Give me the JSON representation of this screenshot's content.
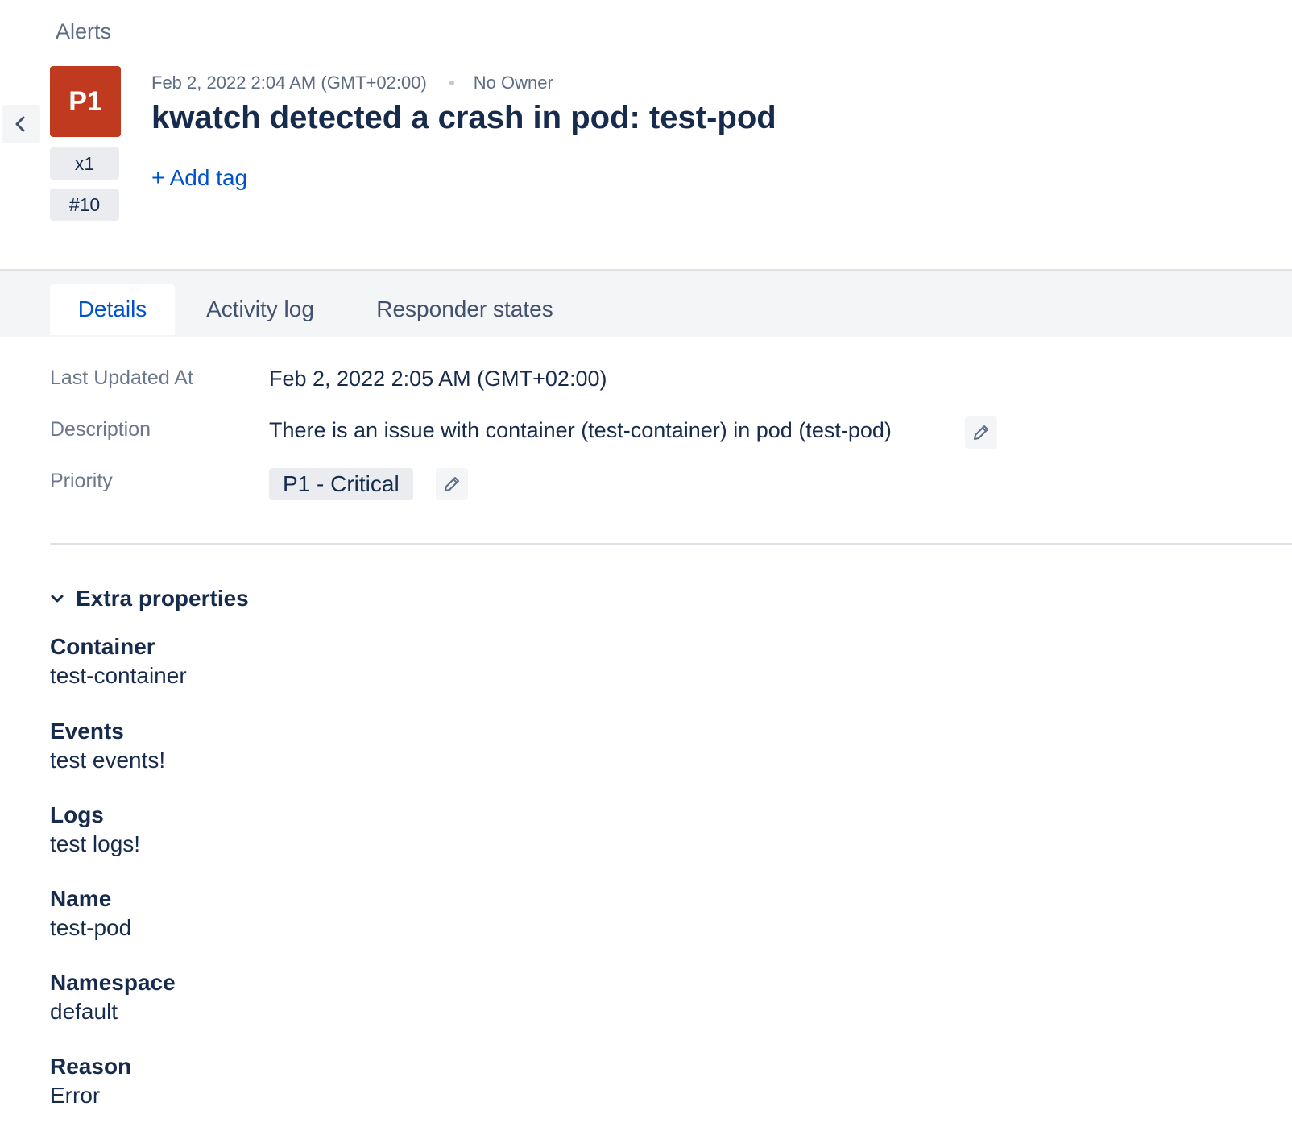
{
  "breadcrumb": "Alerts",
  "alert": {
    "priority_short": "P1",
    "count_label": "x1",
    "number_label": "#10",
    "created_at": "Feb 2, 2022 2:04 AM (GMT+02:00)",
    "owner": "No Owner",
    "title": "kwatch detected a crash in pod: test-pod",
    "add_tag_label": "+ Add tag"
  },
  "tabs": [
    {
      "label": "Details",
      "active": true
    },
    {
      "label": "Activity log",
      "active": false
    },
    {
      "label": "Responder states",
      "active": false
    }
  ],
  "details": {
    "last_updated": {
      "label": "Last Updated At",
      "value": "Feb 2, 2022 2:05 AM (GMT+02:00)"
    },
    "description": {
      "label": "Description",
      "value": "There is an issue with container (test-container) in pod (test-pod)"
    },
    "priority": {
      "label": "Priority",
      "value": "P1 - Critical"
    }
  },
  "extra": {
    "title": "Extra properties",
    "items": [
      {
        "key": "Container",
        "value": "test-container"
      },
      {
        "key": "Events",
        "value": "test events!"
      },
      {
        "key": "Logs",
        "value": "test logs!"
      },
      {
        "key": "Name",
        "value": "test-pod"
      },
      {
        "key": "Namespace",
        "value": "default"
      },
      {
        "key": "Reason",
        "value": "Error"
      }
    ]
  },
  "colors": {
    "priority_p1": "#bf3a1e",
    "link": "#0052cc",
    "text": "#172b4d",
    "muted": "#6b778c"
  }
}
